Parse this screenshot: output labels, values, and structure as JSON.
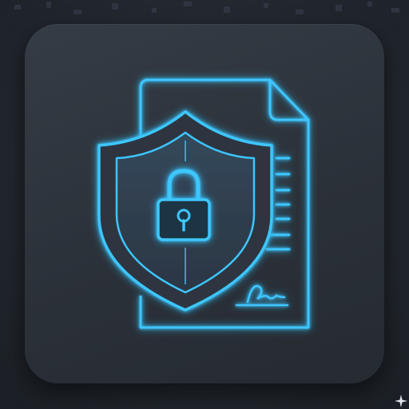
{
  "icon": {
    "name": "document-security-icon",
    "glow_color": "#38c8ff",
    "tile_color": "#2e343c",
    "background_color": "#22272e"
  }
}
